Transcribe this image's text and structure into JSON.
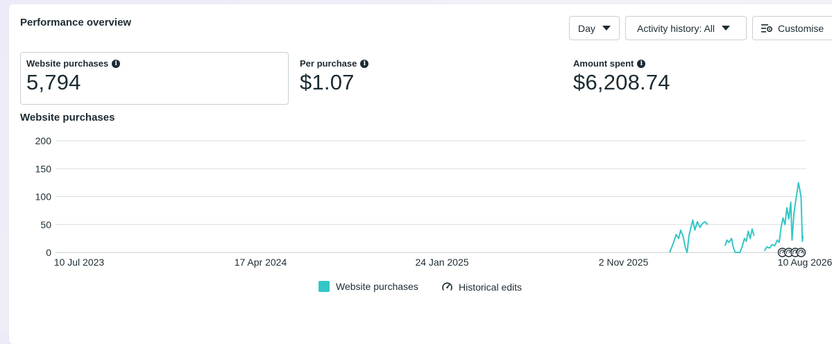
{
  "header": {
    "title": "Performance overview"
  },
  "controls": {
    "day": "Day",
    "activity": "Activity history: All",
    "customise": "Customise"
  },
  "metrics": [
    {
      "label": "Website purchases",
      "value": "5,794"
    },
    {
      "label": "Per purchase",
      "value": "$1.07"
    },
    {
      "label": "Amount spent",
      "value": "$6,208.74"
    }
  ],
  "chart_title": "Website purchases",
  "legend": {
    "series": "Website purchases",
    "edits": "Historical edits"
  },
  "colors": {
    "series": "#34c6c6",
    "grid": "#dadde1",
    "text": "#1c2b33"
  },
  "chart_data": {
    "type": "line",
    "title": "Website purchases",
    "ylim": [
      0,
      200
    ],
    "y_ticks": [
      0,
      50,
      100,
      150,
      200
    ],
    "x_tick_labels": [
      "10 Jul 2023",
      "17 Apr 2024",
      "24 Jan 2025",
      "2 Nov 2025",
      "10 Aug 2026"
    ],
    "x_start": "2023-07-10",
    "x_end": "2026-08-10",
    "series": [
      {
        "name": "Website purchases",
        "points": [
          [
            "2026-01-12",
            0
          ],
          [
            "2026-01-18",
            18
          ],
          [
            "2026-01-22",
            32
          ],
          [
            "2026-01-26",
            25
          ],
          [
            "2026-01-29",
            40
          ],
          [
            "2026-02-02",
            28
          ],
          [
            "2026-02-05",
            10
          ],
          [
            "2026-02-08",
            0
          ],
          [
            "2026-02-11",
            30
          ],
          [
            "2026-02-14",
            45
          ],
          [
            "2026-02-17",
            58
          ],
          [
            "2026-02-20",
            40
          ],
          [
            "2026-02-24",
            55
          ],
          [
            "2026-02-28",
            45
          ],
          [
            "2026-03-04",
            52
          ],
          [
            "2026-03-08",
            55
          ],
          [
            "2026-03-12",
            50
          ],
          [
            "2026-03-16",
            null
          ],
          [
            "2026-04-08",
            12
          ],
          [
            "2026-04-11",
            22
          ],
          [
            "2026-04-14",
            18
          ],
          [
            "2026-04-18",
            25
          ],
          [
            "2026-04-21",
            8
          ],
          [
            "2026-04-24",
            0
          ],
          [
            "2026-05-01",
            0
          ],
          [
            "2026-05-05",
            12
          ],
          [
            "2026-05-08",
            25
          ],
          [
            "2026-05-11",
            20
          ],
          [
            "2026-05-14",
            38
          ],
          [
            "2026-05-17",
            25
          ],
          [
            "2026-05-20",
            42
          ],
          [
            "2026-05-23",
            30
          ],
          [
            "2026-05-26",
            null
          ],
          [
            "2026-06-08",
            3
          ],
          [
            "2026-06-12",
            10
          ],
          [
            "2026-06-16",
            8
          ],
          [
            "2026-06-20",
            14
          ],
          [
            "2026-06-24",
            12
          ],
          [
            "2026-06-28",
            22
          ],
          [
            "2026-07-01",
            18
          ],
          [
            "2026-07-04",
            45
          ],
          [
            "2026-07-07",
            62
          ],
          [
            "2026-07-10",
            50
          ],
          [
            "2026-07-13",
            80
          ],
          [
            "2026-07-16",
            60
          ],
          [
            "2026-07-19",
            90
          ],
          [
            "2026-07-21",
            22
          ],
          [
            "2026-07-24",
            70
          ],
          [
            "2026-07-27",
            95
          ],
          [
            "2026-07-29",
            110
          ],
          [
            "2026-07-31",
            125
          ],
          [
            "2026-08-02",
            112
          ],
          [
            "2026-08-04",
            100
          ],
          [
            "2026-08-06",
            20
          ],
          [
            "2026-08-07",
            30
          ]
        ]
      }
    ],
    "historical_edit_markers": [
      "2026-07-06",
      "2026-07-16",
      "2026-07-26",
      "2026-08-04"
    ]
  }
}
